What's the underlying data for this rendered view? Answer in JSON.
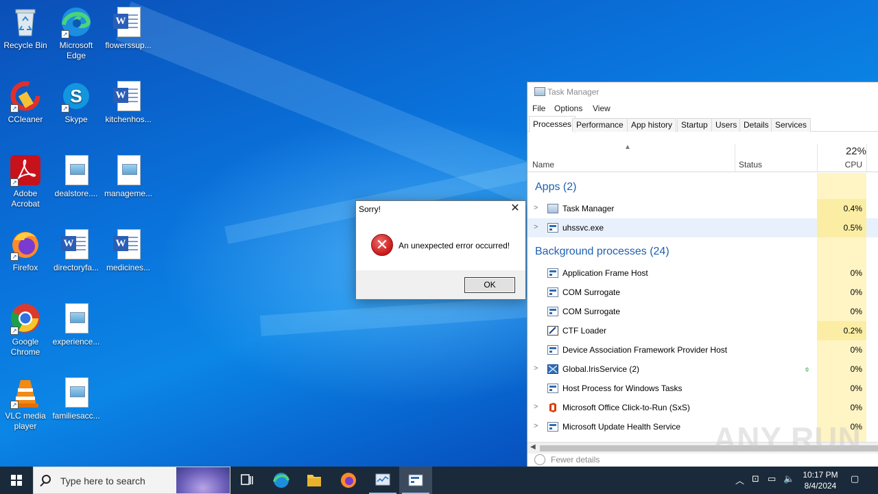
{
  "desktop": {
    "icons": [
      {
        "label": "Recycle Bin",
        "icon": "recycle-bin-icon"
      },
      {
        "label": "Microsoft Edge",
        "icon": "edge-icon"
      },
      {
        "label": "flowerssup...",
        "icon": "word-doc-icon"
      },
      {
        "label": "CCleaner",
        "icon": "ccleaner-icon"
      },
      {
        "label": "Skype",
        "icon": "skype-icon"
      },
      {
        "label": "kitchenhos...",
        "icon": "word-doc-icon"
      },
      {
        "label": "Adobe Acrobat",
        "icon": "acrobat-icon"
      },
      {
        "label": "dealstore....",
        "icon": "image-file-icon"
      },
      {
        "label": "manageme...",
        "icon": "image-file-icon"
      },
      {
        "label": "Firefox",
        "icon": "firefox-icon"
      },
      {
        "label": "directoryfa...",
        "icon": "word-doc-icon"
      },
      {
        "label": "medicines...",
        "icon": "word-doc-icon"
      },
      {
        "label": "Google Chrome",
        "icon": "chrome-icon"
      },
      {
        "label": "experience...",
        "icon": "image-file-icon"
      },
      {
        "label": "VLC media player",
        "icon": "vlc-icon"
      },
      {
        "label": "familiesacc...",
        "icon": "image-file-icon"
      }
    ]
  },
  "dialog": {
    "title": "Sorry!",
    "message": "An unexpected error occurred!",
    "ok_label": "OK",
    "close_glyph": "✕"
  },
  "taskmgr": {
    "title": "Task Manager",
    "menu": [
      "File",
      "Options",
      "View"
    ],
    "tabs": [
      "Processes",
      "Performance",
      "App history",
      "Startup",
      "Users",
      "Details",
      "Services"
    ],
    "active_tab": "Processes",
    "columns": {
      "name": "Name",
      "status": "Status",
      "cpu_total": "22%",
      "cpu": "CPU"
    },
    "groups": {
      "apps": "Apps (2)",
      "background": "Background processes (24)"
    },
    "apps": [
      {
        "name": "Task Manager",
        "cpu": "0.4%",
        "expandable": true
      },
      {
        "name": "uhssvc.exe",
        "cpu": "0.5%",
        "expandable": true
      }
    ],
    "background": [
      {
        "name": "Application Frame Host",
        "cpu": "0%",
        "expandable": false
      },
      {
        "name": "COM Surrogate",
        "cpu": "0%",
        "expandable": false
      },
      {
        "name": "COM Surrogate",
        "cpu": "0%",
        "expandable": false
      },
      {
        "name": "CTF Loader",
        "cpu": "0.2%",
        "expandable": false
      },
      {
        "name": "Device Association Framework Provider Host",
        "cpu": "0%",
        "expandable": false
      },
      {
        "name": "Global.IrisService (2)",
        "cpu": "0%",
        "expandable": true
      },
      {
        "name": "Host Process for Windows Tasks",
        "cpu": "0%",
        "expandable": false
      },
      {
        "name": "Microsoft Office Click-to-Run (SxS)",
        "cpu": "0%",
        "expandable": true
      },
      {
        "name": "Microsoft Update Health Service",
        "cpu": "0%",
        "expandable": true
      }
    ],
    "footer": "Fewer details"
  },
  "watermark": "ANY RUN",
  "taskbar": {
    "search_placeholder": "Type here to search",
    "clock_time": "10:17 PM",
    "clock_date": "8/4/2024"
  }
}
